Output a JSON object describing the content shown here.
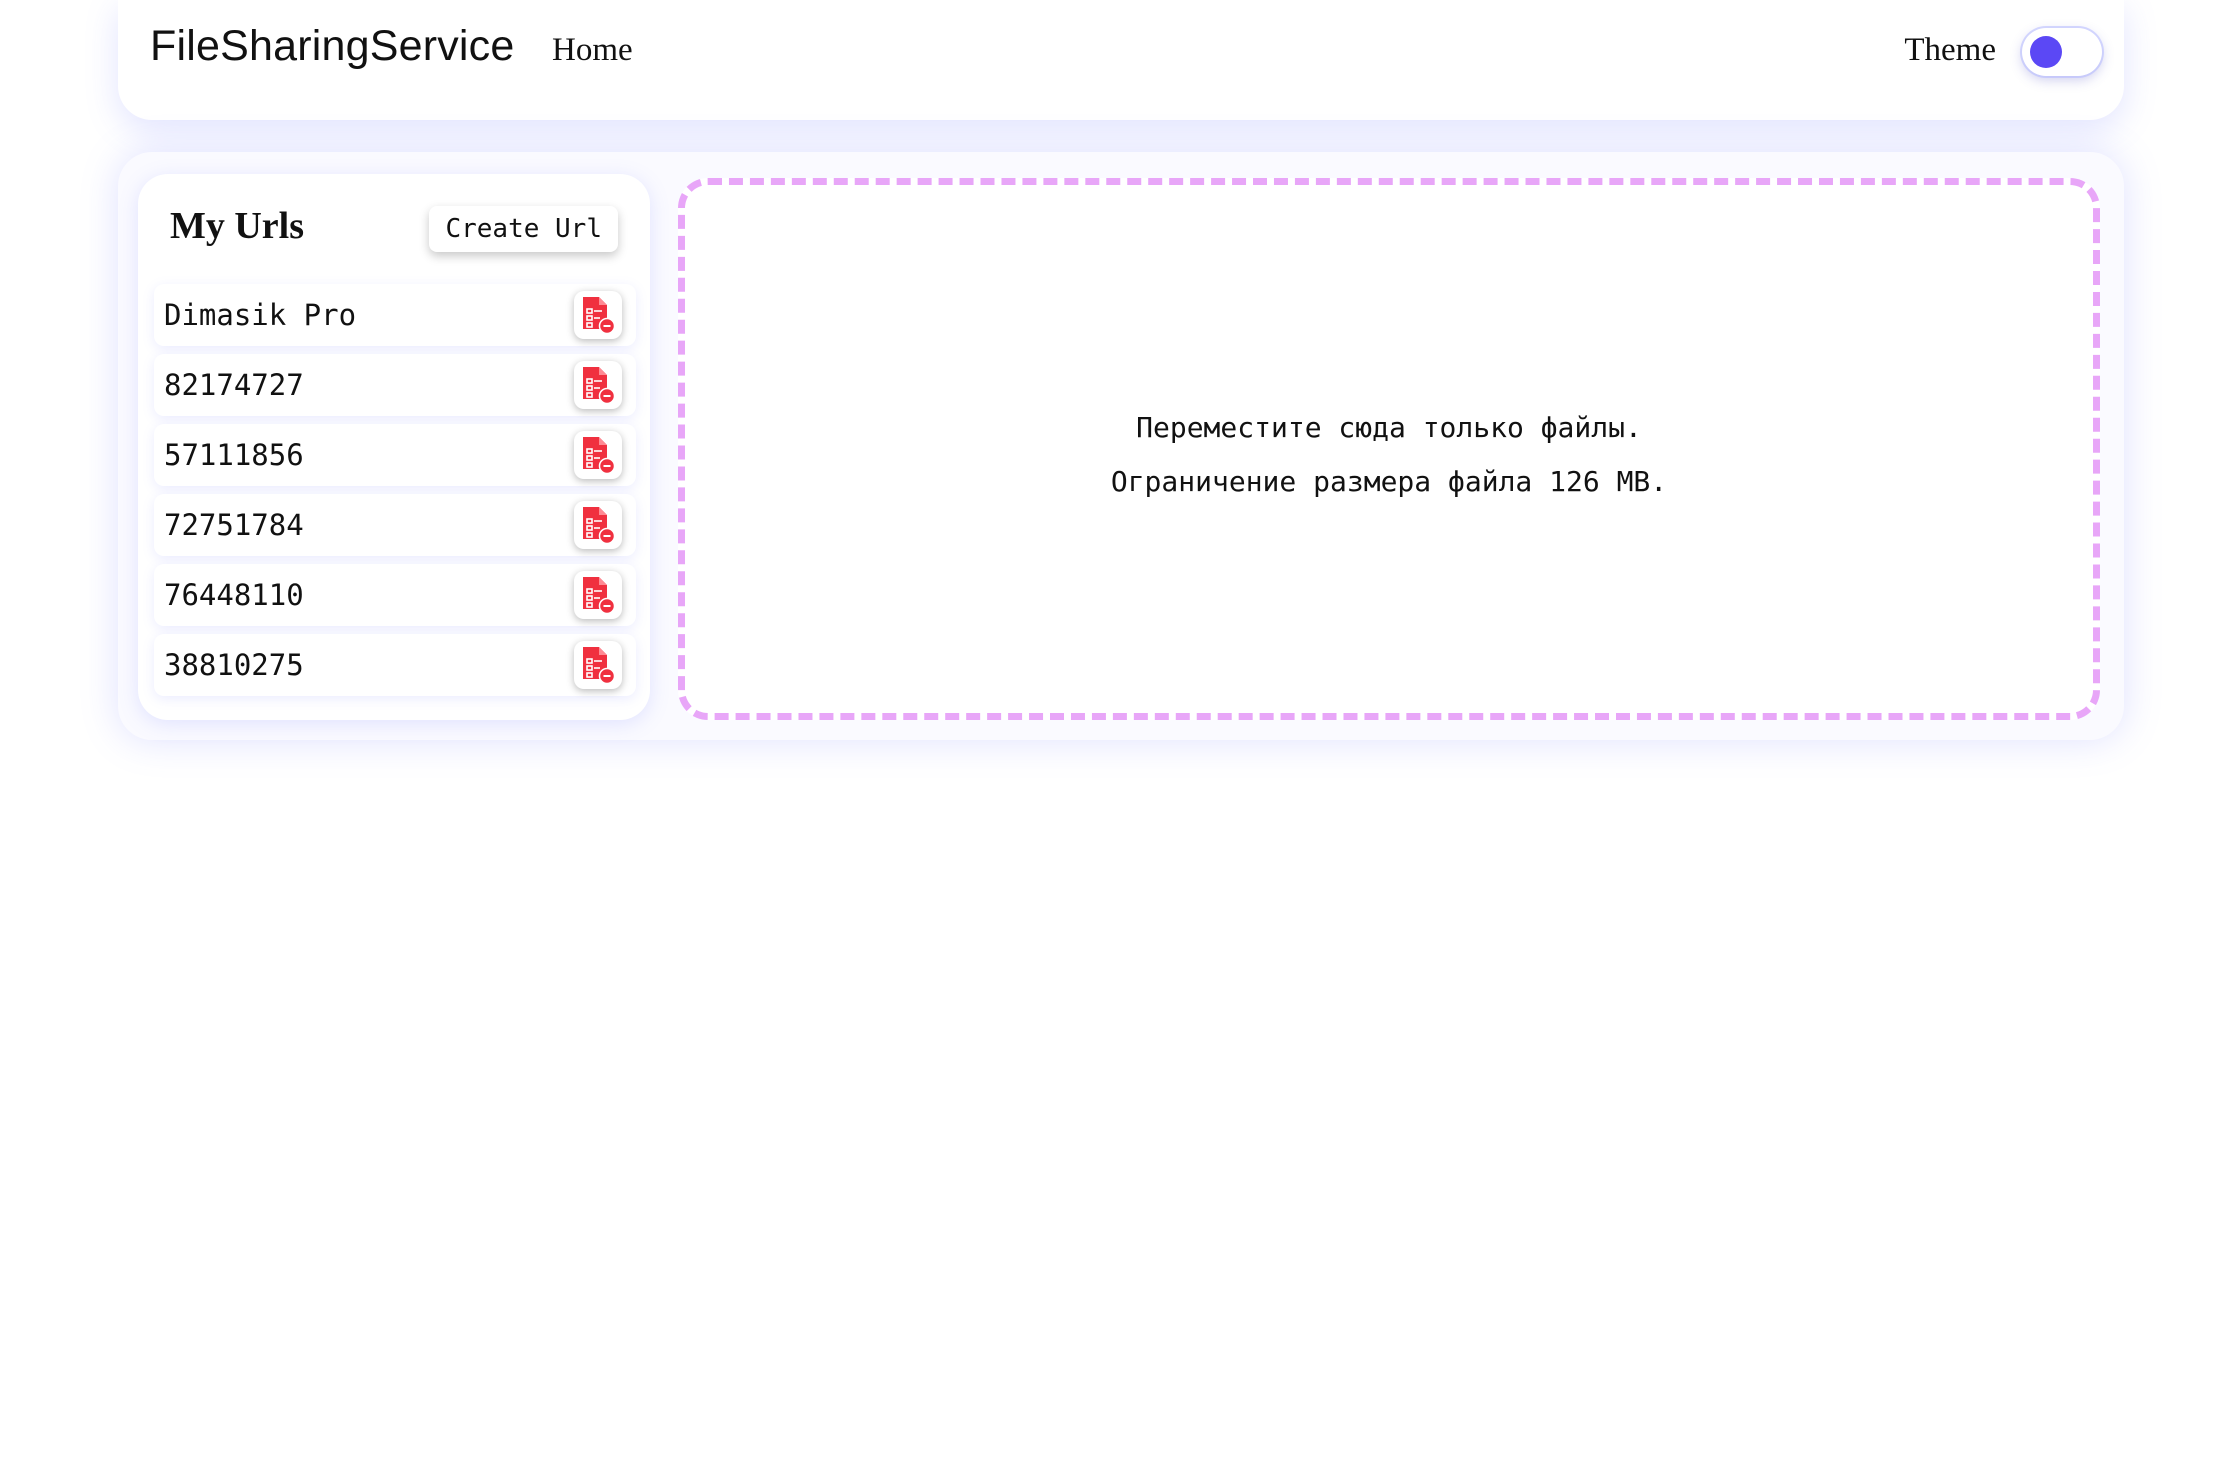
{
  "header": {
    "brand": "FileSharingService",
    "nav": [
      {
        "label": "Home"
      }
    ],
    "theme_label": "Theme",
    "theme_toggle": {
      "on": false,
      "knob_color": "#5b48f5"
    }
  },
  "sidebar": {
    "title": "My Urls",
    "create_button": "Create Url",
    "urls": [
      {
        "name": "Dimasik Pro"
      },
      {
        "name": "82174727"
      },
      {
        "name": "57111856"
      },
      {
        "name": "72751784"
      },
      {
        "name": "76448110"
      },
      {
        "name": "38810275"
      }
    ],
    "delete_icon": "file-delete-icon",
    "delete_icon_color": "#f0303f"
  },
  "dropzone": {
    "line1": "Переместите сюда только файлы.",
    "line2": "Ограничение размера файла 126 MB.",
    "border_color": "#e8a6f8"
  },
  "colors": {
    "accent": "#5b48f5",
    "shadow_tint": "#6e78ff"
  }
}
